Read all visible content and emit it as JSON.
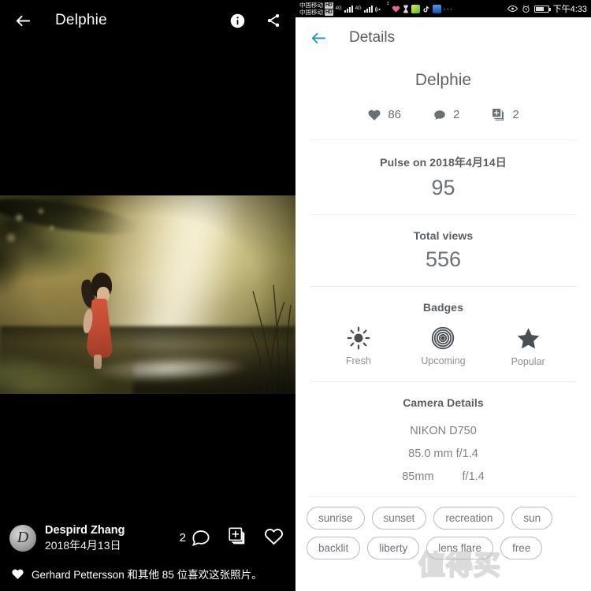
{
  "viewer": {
    "back_icon": "arrow-left-icon",
    "title": "Delphie",
    "info_icon": "info-icon",
    "share_icon": "share-icon",
    "photo_alt": "girl-in-red-dress-golden-hour",
    "author": {
      "avatar_letter": "D",
      "name": "Despird Zhang",
      "date": "2018年4月13日"
    },
    "actions": {
      "comment_count": "2",
      "comment_icon": "comment-icon",
      "add-to-album_icon": "add-to-album-icon",
      "like_icon": "heart-outline-icon"
    },
    "likes_icon": "heart-filled-icon",
    "likes_text": "Gerhard Pettersson 和其他 85 位喜欢这张照片。"
  },
  "statusbar": {
    "carrier_line1": "中国移动",
    "carrier_line2": "中国移动",
    "hd_badge": "HD",
    "net1": "4G",
    "net2": "4G",
    "wifi_icon": "wifi-icon",
    "wifi_sup": "2",
    "heart_icon": "heart-icon",
    "hourglass_icon": "hourglass-icon",
    "app1_icon": "wechat-icon",
    "app2_icon": "tiktok-icon",
    "app3_icon": "app-icon",
    "more_icon": "more-icon",
    "eye_icon": "eye-icon",
    "alarm_icon": "alarm-icon",
    "battery_icon": "battery-icon",
    "time": "下午4:33"
  },
  "details": {
    "back_icon": "arrow-left-icon",
    "back_color": "#2196c4",
    "title": "Details",
    "photo_title": "Delphie",
    "stats": [
      {
        "icon": "heart-filled-icon",
        "value": "86"
      },
      {
        "icon": "comment-icon",
        "value": "2"
      },
      {
        "icon": "add-to-album-icon",
        "value": "2"
      }
    ],
    "pulse": {
      "title": "Pulse on 2018年4月14日",
      "value": "95"
    },
    "views": {
      "title": "Total views",
      "value": "556"
    },
    "badges": {
      "title": "Badges",
      "items": [
        {
          "icon": "sun-icon",
          "label": "Fresh"
        },
        {
          "icon": "target-icon",
          "label": "Upcoming"
        },
        {
          "icon": "star-icon",
          "label": "Popular"
        }
      ]
    },
    "camera": {
      "title": "Camera Details",
      "model": "NIKON D750",
      "lens": "85.0 mm f/1.4",
      "focal_length": "85mm",
      "aperture": "f/1.4"
    },
    "tags": [
      "sunrise",
      "sunset",
      "recreation",
      "sun",
      "backlit",
      "liberty",
      "lens flare",
      "free"
    ],
    "watermark": "值得买"
  }
}
